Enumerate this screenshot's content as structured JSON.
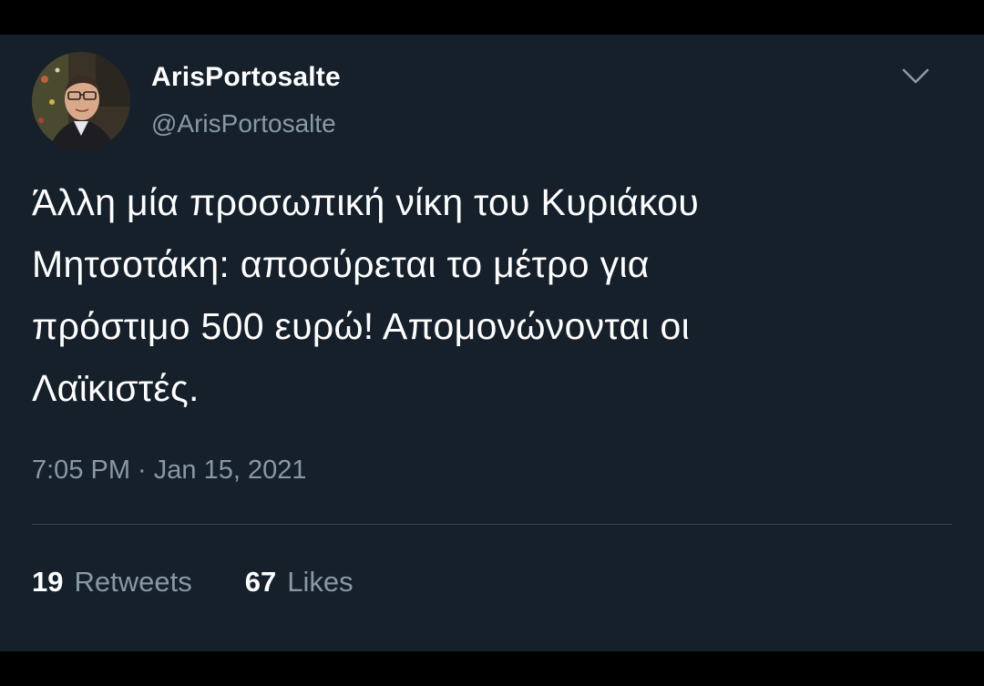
{
  "tweet": {
    "display_name": "ArisPortosalte",
    "handle": "@ArisPortosalte",
    "text": "Άλλη μία προσωπική νίκη του Κυριάκου\nΜητσοτάκη: αποσύρεται το μέτρο για\nπρόστιμο 500 ευρώ! Απομονώνονται οι\nΛαϊκιστές.",
    "timestamp": "7:05 PM · Jan 15, 2021",
    "retweets": {
      "count": "19",
      "label": "Retweets"
    },
    "likes": {
      "count": "67",
      "label": "Likes"
    },
    "menu_icon": "chevron-down-icon"
  },
  "colors": {
    "background": "#15202b",
    "text_primary": "#ffffff",
    "text_secondary": "#8899a6",
    "divider": "#38444d",
    "letterbox": "#000000"
  }
}
